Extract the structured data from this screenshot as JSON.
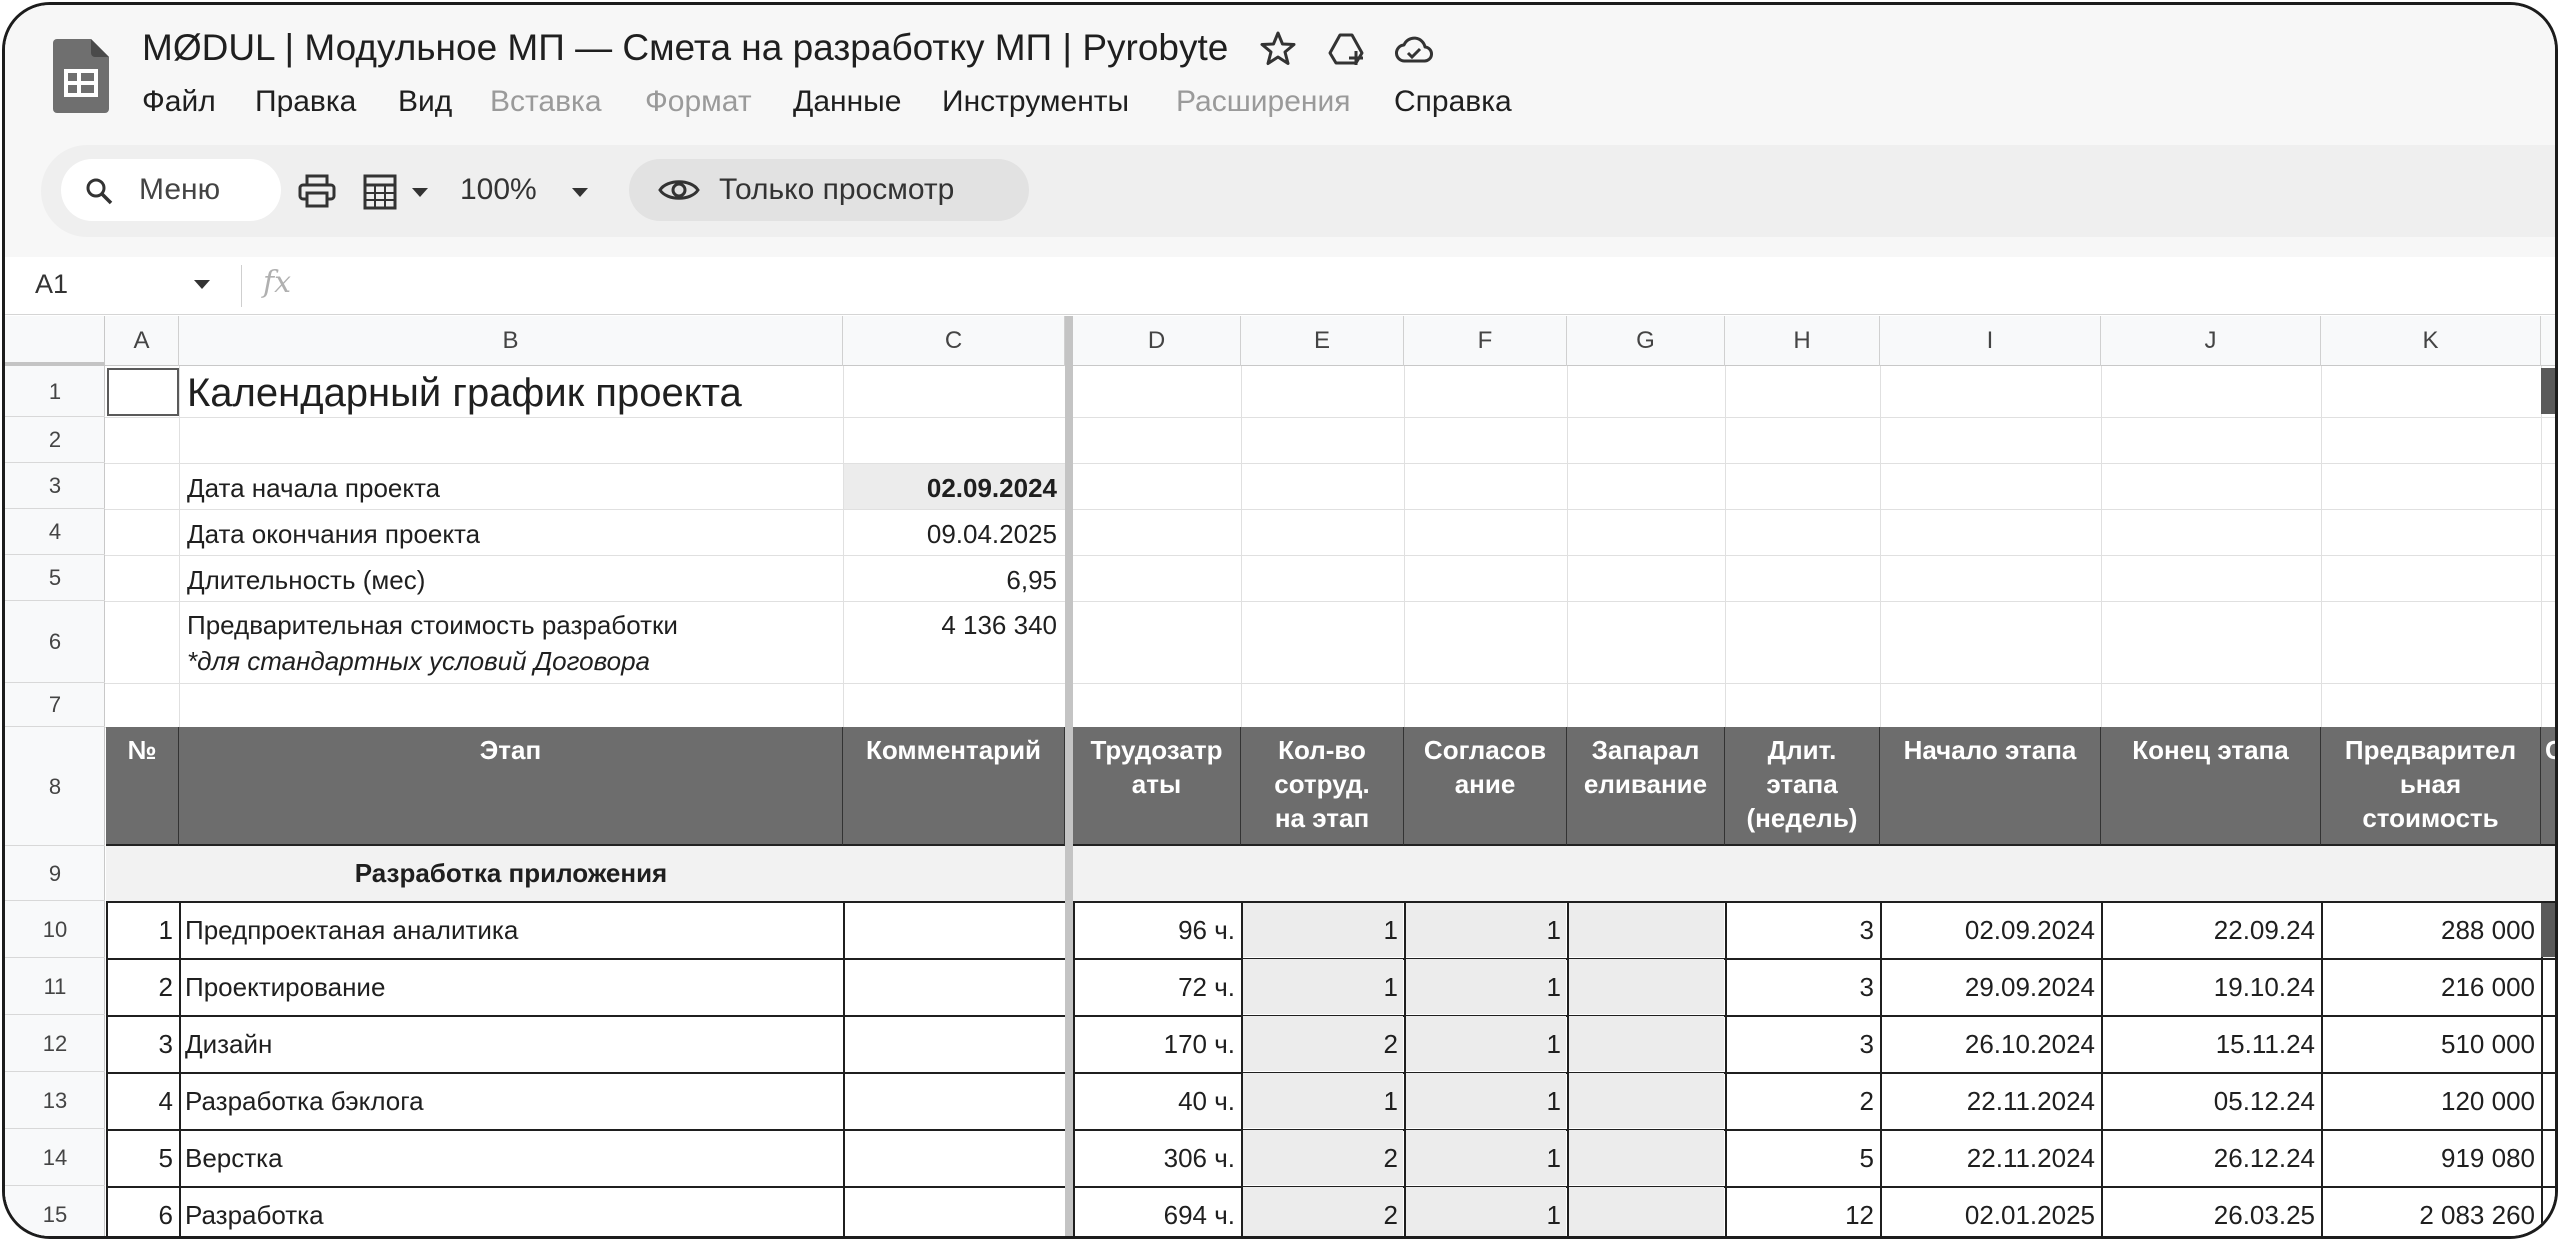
{
  "app": {
    "doc_title": "MØDUL | Модульное МП — Смета на разработку МП | Pyrobyte",
    "icons": [
      "sheets-app-icon",
      "star-icon",
      "move-to-drive-icon",
      "cloud-status-icon"
    ]
  },
  "menu": {
    "items": [
      {
        "label": "Файл",
        "disabled": false
      },
      {
        "label": "Правка",
        "disabled": false
      },
      {
        "label": "Вид",
        "disabled": false
      },
      {
        "label": "Вставка",
        "disabled": true
      },
      {
        "label": "Формат",
        "disabled": true
      },
      {
        "label": "Данные",
        "disabled": false
      },
      {
        "label": "Инструменты",
        "disabled": false
      },
      {
        "label": "Расширения",
        "disabled": true
      },
      {
        "label": "Справка",
        "disabled": false
      }
    ]
  },
  "toolbar": {
    "search_label": "Меню",
    "zoom": "100%",
    "view_mode": "Только просмотр"
  },
  "formula_bar": {
    "name_box": "A1",
    "fx": "fx"
  },
  "grid": {
    "columns": [
      "A",
      "B",
      "C",
      "D",
      "E",
      "F",
      "G",
      "H",
      "I",
      "J",
      "K"
    ],
    "rows": [
      "1",
      "2",
      "3",
      "4",
      "5",
      "6",
      "7",
      "8",
      "9",
      "10",
      "11",
      "12",
      "13",
      "14",
      "15"
    ]
  },
  "sheet": {
    "title": "Календарный график проекта",
    "info": {
      "start_label": "Дата начала проекта",
      "start_value": "02.09.2024",
      "end_label": "Дата окончания проекта",
      "end_value": "09.04.2025",
      "duration_label": "Длительность (мес)",
      "duration_value": "6,95",
      "cost_label": "Предварительная стоимость разработки",
      "cost_note": "*для стандартных условий Договора",
      "cost_value": "4 136 340"
    },
    "table_headers": [
      "№",
      "Этап",
      "Комментарий",
      "Трудозатр\nаты",
      "Кол-во\nсотруд.\nна этап",
      "Согласов\nание",
      "Запарал\nеливание",
      "Длит.\nэтапа\n(недель)",
      "Начало этапа",
      "Конец этапа",
      "Предварител\nьная\nстоимость",
      "С"
    ],
    "phase_label": "Разработка приложения",
    "rows": [
      {
        "num": "1",
        "stage": "Предпроектаная аналитика",
        "comment": "",
        "effort": "96 ч.",
        "staff": "1",
        "approval": "1",
        "parallel": "",
        "weeks": "3",
        "start": "02.09.2024",
        "end": "22.09.24",
        "cost": "288 000"
      },
      {
        "num": "2",
        "stage": "Проектирование",
        "comment": "",
        "effort": "72 ч.",
        "staff": "1",
        "approval": "1",
        "parallel": "",
        "weeks": "3",
        "start": "29.09.2024",
        "end": "19.10.24",
        "cost": "216 000"
      },
      {
        "num": "3",
        "stage": "Дизайн",
        "comment": "",
        "effort": "170 ч.",
        "staff": "2",
        "approval": "1",
        "parallel": "",
        "weeks": "3",
        "start": "26.10.2024",
        "end": "15.11.24",
        "cost": "510 000"
      },
      {
        "num": "4",
        "stage": "Разработка бэклога",
        "comment": "",
        "effort": "40 ч.",
        "staff": "1",
        "approval": "1",
        "parallel": "",
        "weeks": "2",
        "start": "22.11.2024",
        "end": "05.12.24",
        "cost": "120 000"
      },
      {
        "num": "5",
        "stage": "Верстка",
        "comment": "",
        "effort": "306 ч.",
        "staff": "2",
        "approval": "1",
        "parallel": "",
        "weeks": "5",
        "start": "22.11.2024",
        "end": "26.12.24",
        "cost": "919 080"
      },
      {
        "num": "6",
        "stage": "Разработка",
        "comment": "",
        "effort": "694 ч.",
        "staff": "2",
        "approval": "1",
        "parallel": "",
        "weeks": "12",
        "start": "02.01.2025",
        "end": "26.03.25",
        "cost": "2 083 260"
      }
    ]
  }
}
